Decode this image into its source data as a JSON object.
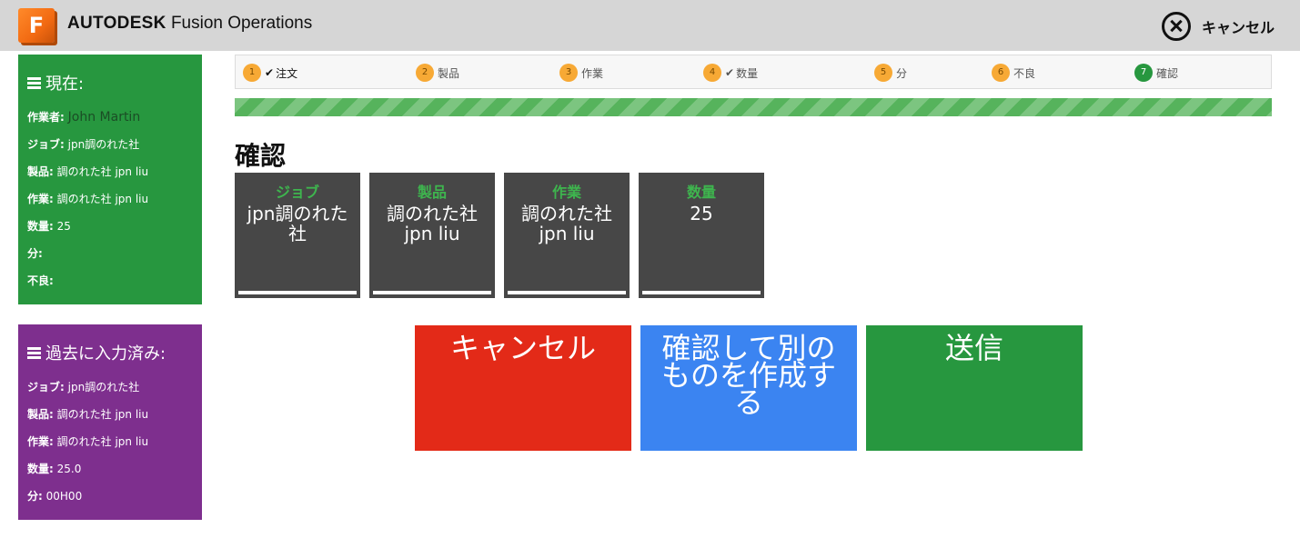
{
  "header": {
    "logo_letter": "F",
    "brand_strong": "AUTODESK",
    "brand_rest": "Fusion Operations",
    "cancel_label": "キャンセル"
  },
  "current_panel": {
    "title": "現在:",
    "rows": [
      {
        "key": "作業者:",
        "value": "John Martin"
      },
      {
        "key": "ジョブ:",
        "value": "jpn調のれた社"
      },
      {
        "key": "製品:",
        "value": "調のれた社 jpn liu"
      },
      {
        "key": "作業:",
        "value": "調のれた社 jpn liu"
      },
      {
        "key": "数量:",
        "value": "25"
      },
      {
        "key": "分:",
        "value": ""
      },
      {
        "key": "不良:",
        "value": ""
      }
    ]
  },
  "past_panel": {
    "title": "過去に入力済み:",
    "rows": [
      {
        "key": "ジョブ:",
        "value": "jpn調のれた社"
      },
      {
        "key": "製品:",
        "value": "調のれた社 jpn liu"
      },
      {
        "key": "作業:",
        "value": "調のれた社 jpn liu"
      },
      {
        "key": "数量:",
        "value": "25.0"
      },
      {
        "key": "分:",
        "value": "00H00"
      }
    ]
  },
  "steps": [
    {
      "num": "1",
      "label": "注文",
      "check": "✔"
    },
    {
      "num": "2",
      "label": "製品",
      "check": ""
    },
    {
      "num": "3",
      "label": "作業",
      "check": ""
    },
    {
      "num": "4",
      "label": "数量",
      "check": "✔"
    },
    {
      "num": "5",
      "label": "分",
      "check": ""
    },
    {
      "num": "6",
      "label": "不良",
      "check": ""
    },
    {
      "num": "7",
      "label": "確認",
      "check": ""
    }
  ],
  "progress": {
    "percent": 100
  },
  "heading": "確認",
  "tiles": [
    {
      "label": "ジョブ",
      "value": "jpn調のれた社"
    },
    {
      "label": "製品",
      "value": "調のれた社 jpn liu"
    },
    {
      "label": "作業",
      "value": "調のれた社 jpn liu"
    },
    {
      "label": "数量",
      "value": "25"
    }
  ],
  "actions": {
    "cancel": "キャンセル",
    "confirm_new": "確認して別のものを作成する",
    "submit": "送信"
  },
  "colors": {
    "current_panel": "#27973f",
    "past_panel": "#7e2f8e",
    "cancel_button": "#e32a18",
    "confirm_button": "#3b84f1",
    "submit_button": "#27973f",
    "tile_bg": "#474747",
    "step_badge": "#f7a935"
  }
}
